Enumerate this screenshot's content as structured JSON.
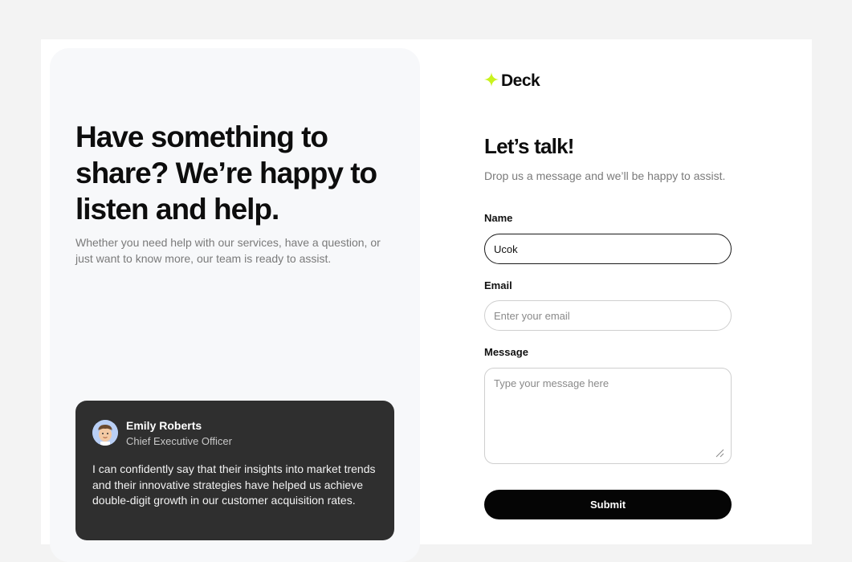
{
  "colors": {
    "accent": "#c9f31d",
    "panel_bg": "#f7f8fa",
    "testimonial_bg": "#2f2f2f",
    "button_bg": "#050505"
  },
  "hero": {
    "title_lines": [
      "Have something to",
      "share? We’re happy to",
      "listen and help."
    ],
    "subtitle": "Whether you need help with our services, have a question, or just want to know more, our team is ready to assist."
  },
  "testimonial": {
    "avatar_icon": "avatar-icon",
    "name": "Emily Roberts",
    "role": "Chief Executive Officer",
    "quote": "I can confidently say that their insights into market trends and their innovative strategies have helped us achieve double-digit growth in our customer acquisition rates."
  },
  "brand": {
    "logo_icon": "sparkle-icon",
    "name": "Deck"
  },
  "form": {
    "title": "Let’s talk!",
    "subtitle": "Drop us a message and we’ll be happy to assist.",
    "name": {
      "label": "Name",
      "value": "Ucok"
    },
    "email": {
      "label": "Email",
      "placeholder": "Enter your email"
    },
    "message": {
      "label": "Message",
      "placeholder": "Type your message here"
    },
    "submit_label": "Submit"
  }
}
